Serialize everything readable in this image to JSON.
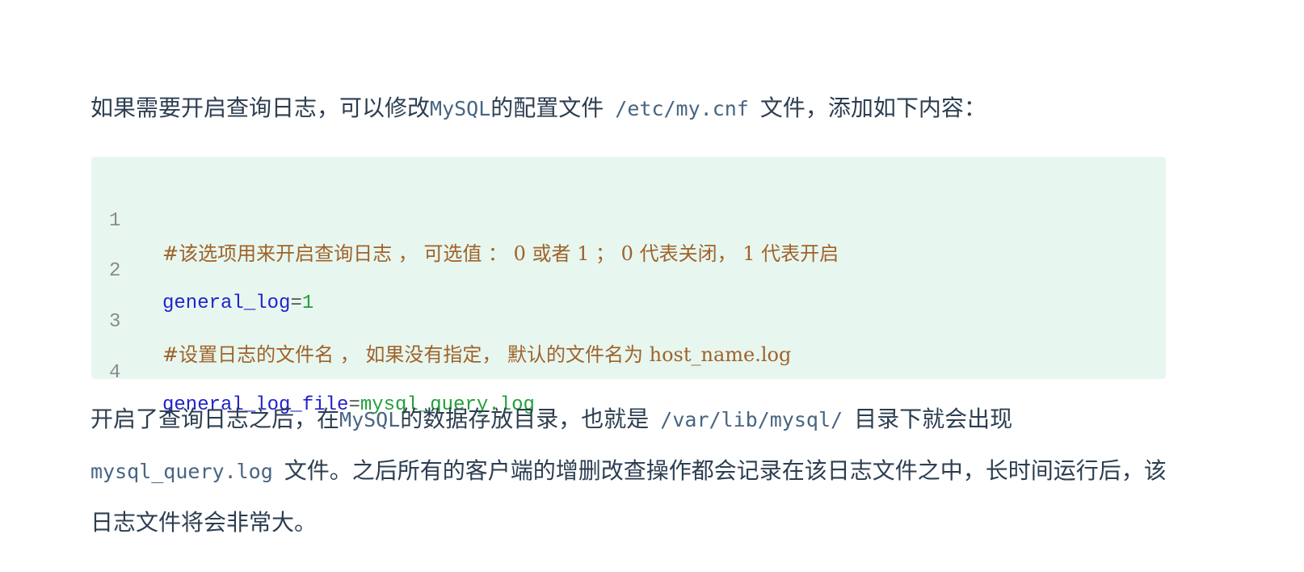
{
  "paragraph1": {
    "text_before": "如果需要开启查询日志，可以修改",
    "mysql": "MySQL",
    "text_mid": "的配置文件",
    "code": "/etc/my.cnf",
    "text_after": "文件，添加如下内容："
  },
  "code_block": {
    "lines": [
      {
        "number": "1",
        "comment": "#该选项用来开启查询日志 ， 可选值 ： 0 或者 1 ； 0 代表关闭， 1 代表开启"
      },
      {
        "number": "2",
        "key": "general_log",
        "eq": "=",
        "value": "1"
      },
      {
        "number": "3",
        "comment": "#设置日志的文件名 ， 如果没有指定， 默认的文件名为 host_name.log"
      },
      {
        "number": "4",
        "key": "general_log_file",
        "eq": "=",
        "value": "mysql_query.log"
      }
    ]
  },
  "paragraph2": {
    "text_before": "开启了查询日志之后，在",
    "mysql": "MySQL",
    "text_mid": "的数据存放目录，也就是",
    "code_dir": "/var/lib/mysql/",
    "text_mid2": "目录下就会出现",
    "code_file": "mysql_query.log",
    "text_after": "文件。之后所有的客户端的增删改查操作都会记录在该日志文件之中，长时间运行后，该日志文件将会非常大。"
  }
}
